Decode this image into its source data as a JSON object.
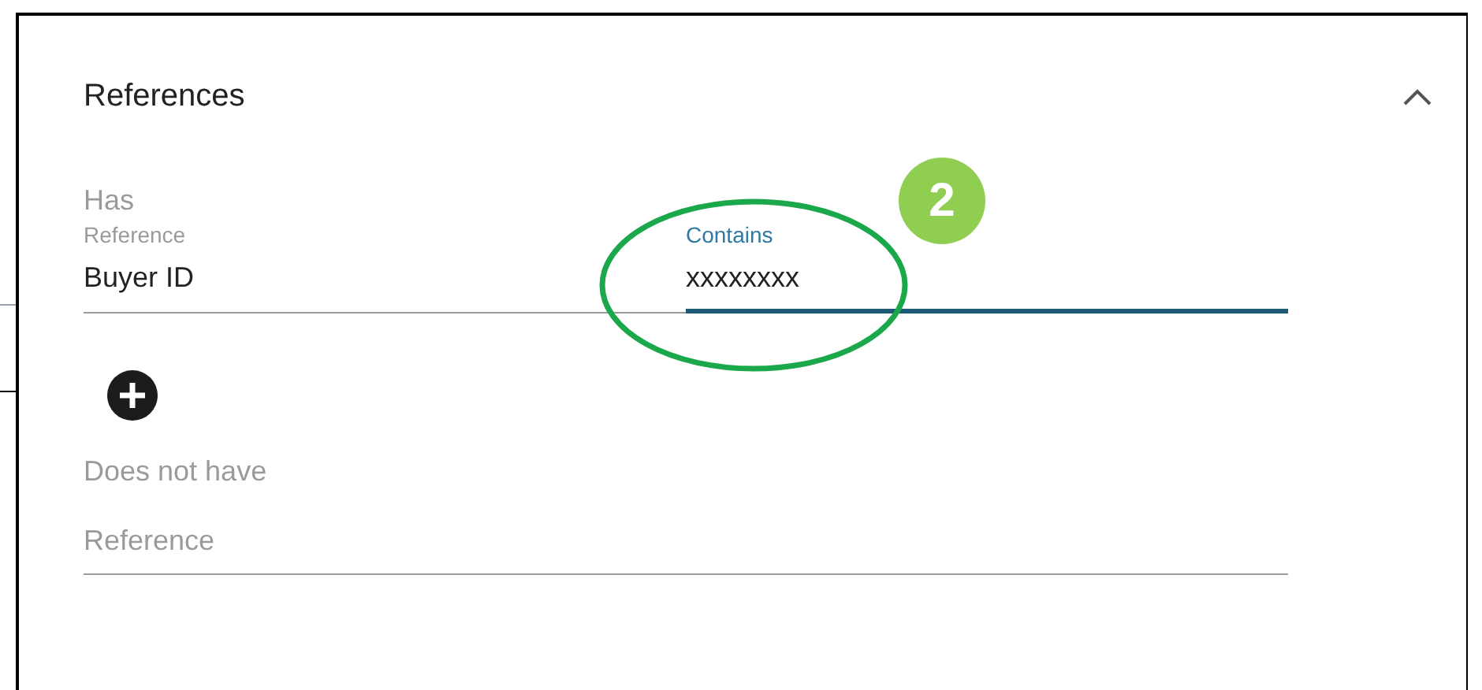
{
  "section": {
    "title": "References",
    "expanded": true
  },
  "has": {
    "label": "Has",
    "reference": {
      "label": "Reference",
      "value": "Buyer ID",
      "focused": false
    },
    "contains": {
      "label": "Contains",
      "value": "xxxxxxxx",
      "focused": true
    }
  },
  "does_not_have": {
    "label": "Does not have",
    "reference": {
      "placeholder": "Reference"
    }
  },
  "annotation": {
    "number": "2"
  }
}
